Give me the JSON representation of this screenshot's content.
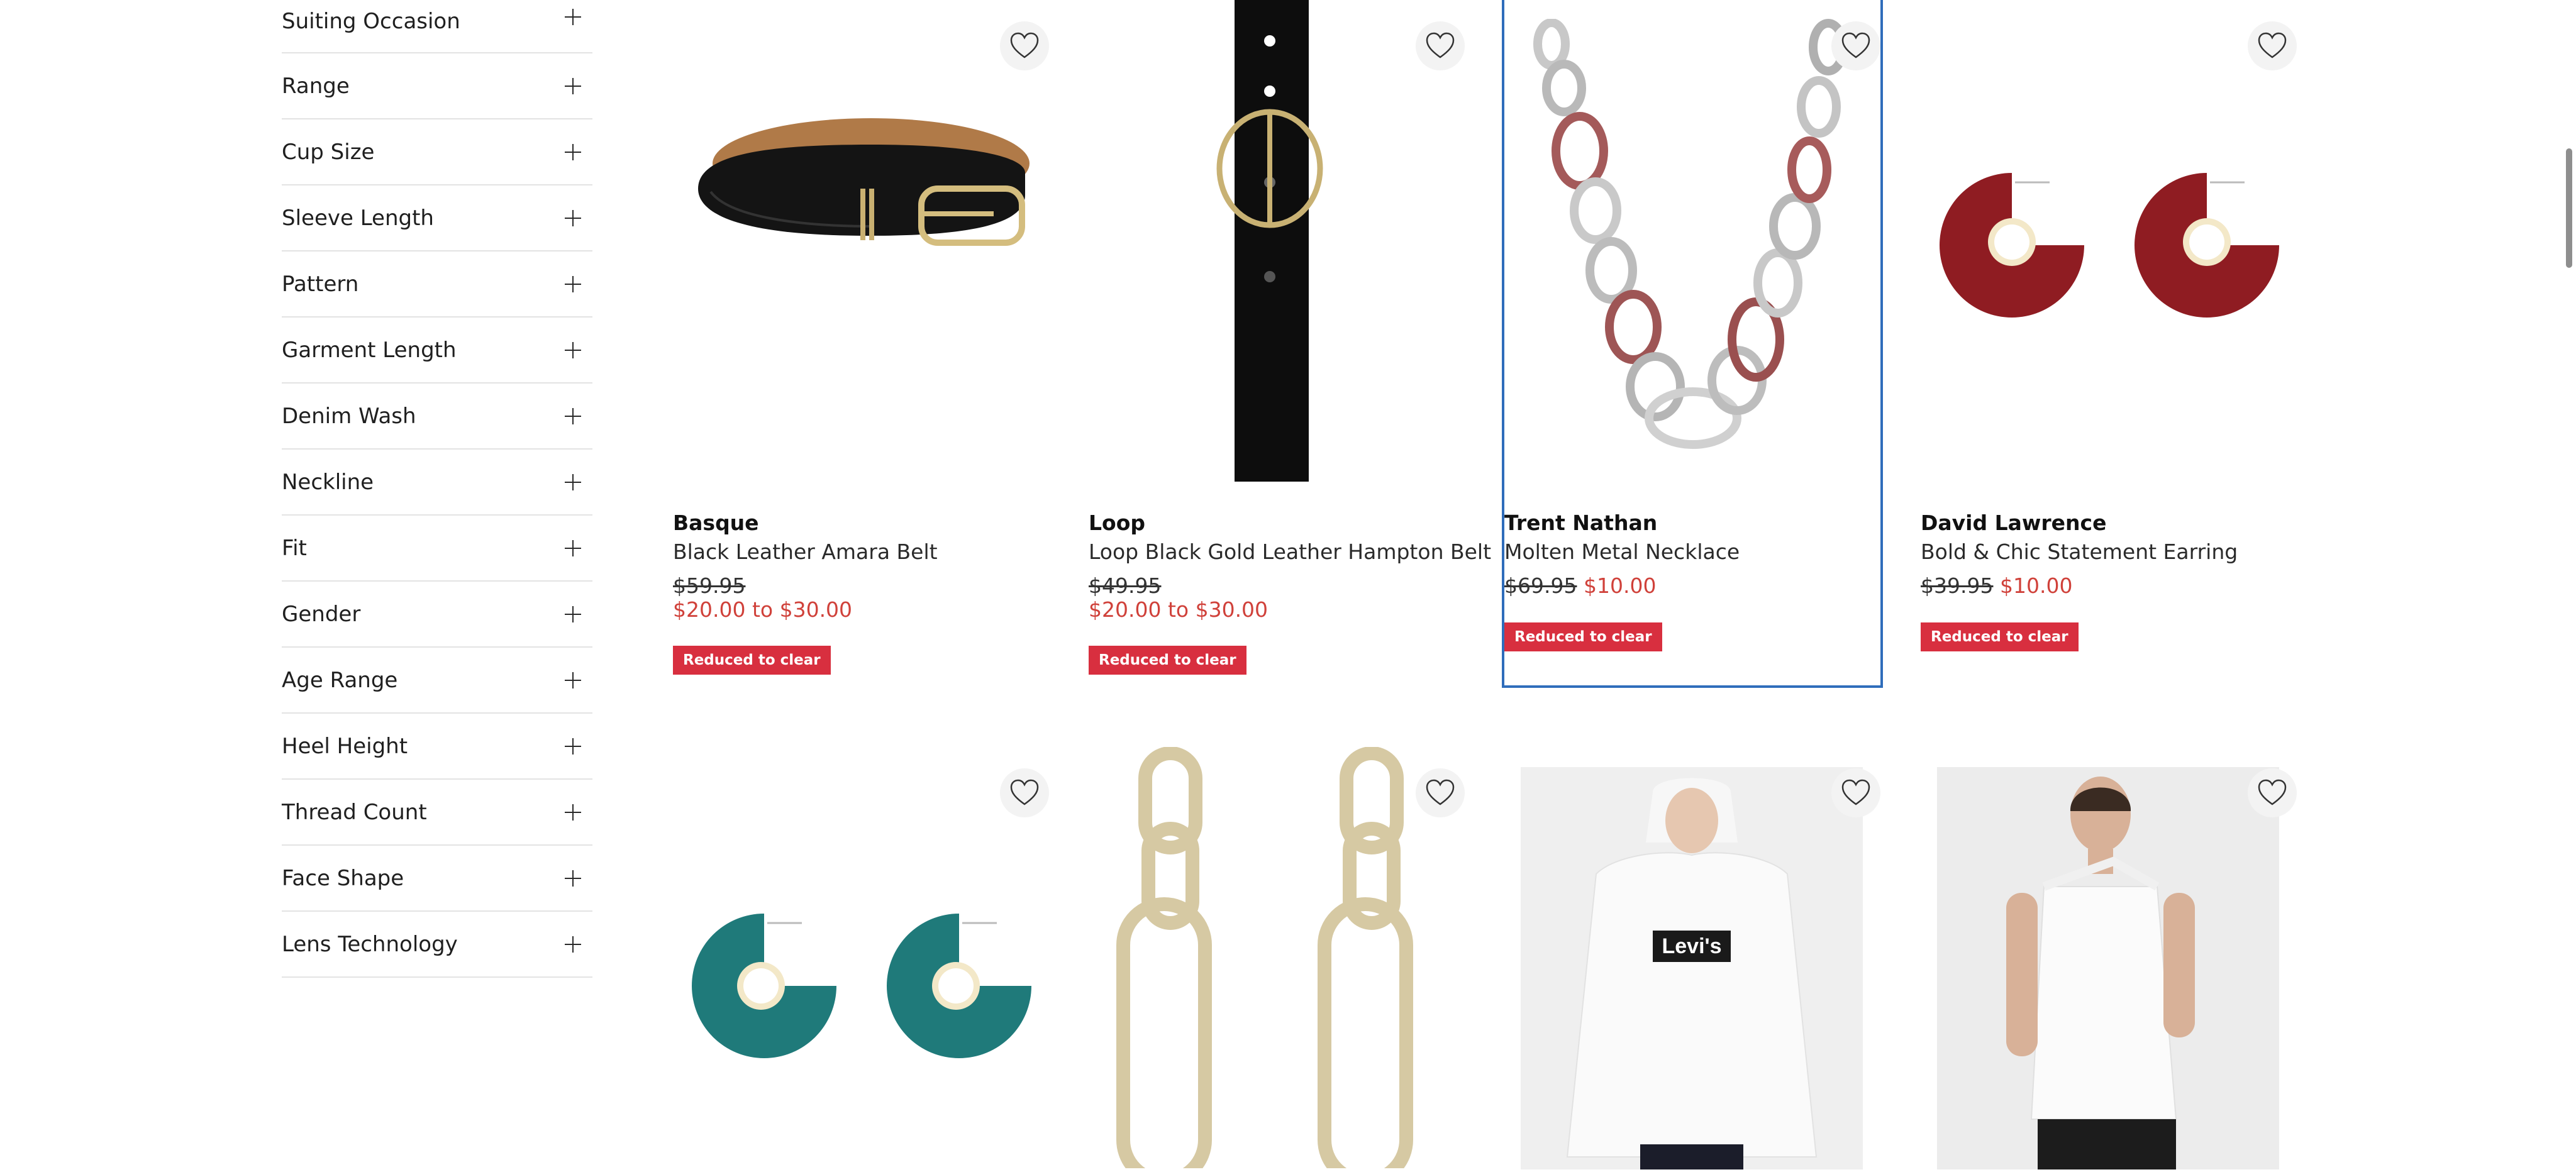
{
  "filters": [
    {
      "label": "Suiting Occasion"
    },
    {
      "label": "Range"
    },
    {
      "label": "Cup Size"
    },
    {
      "label": "Sleeve Length"
    },
    {
      "label": "Pattern"
    },
    {
      "label": "Garment Length"
    },
    {
      "label": "Denim Wash"
    },
    {
      "label": "Neckline"
    },
    {
      "label": "Fit"
    },
    {
      "label": "Gender"
    },
    {
      "label": "Age Range"
    },
    {
      "label": "Heel Height"
    },
    {
      "label": "Thread Count"
    },
    {
      "label": "Face Shape"
    },
    {
      "label": "Lens Technology"
    }
  ],
  "products": [
    {
      "brand": "Basque",
      "name": "Black Leather Amara Belt",
      "was": "$59.95",
      "now": "$20.00 to $30.00",
      "badge": "Reduced to clear"
    },
    {
      "brand": "Loop",
      "name": "Loop Black Gold Leather Hampton Belt",
      "was": "$49.95",
      "now": "$20.00 to $30.00",
      "badge": "Reduced to clear"
    },
    {
      "brand": "Trent Nathan",
      "name": "Molten Metal Necklace",
      "was": "$69.95",
      "now": "$10.00",
      "badge": "Reduced to clear"
    },
    {
      "brand": "David Lawrence",
      "name": "Bold & Chic Statement Earring",
      "was": "$39.95",
      "now": "$10.00",
      "badge": "Reduced to clear"
    }
  ],
  "photo_logo_text": "Levi's",
  "colors": {
    "badge": "#d82f3f",
    "sale_price": "#d0413a",
    "selected_outline": "#2f6dbb"
  },
  "icons": {
    "wishlist": "heart-icon",
    "expand": "plus-icon"
  }
}
